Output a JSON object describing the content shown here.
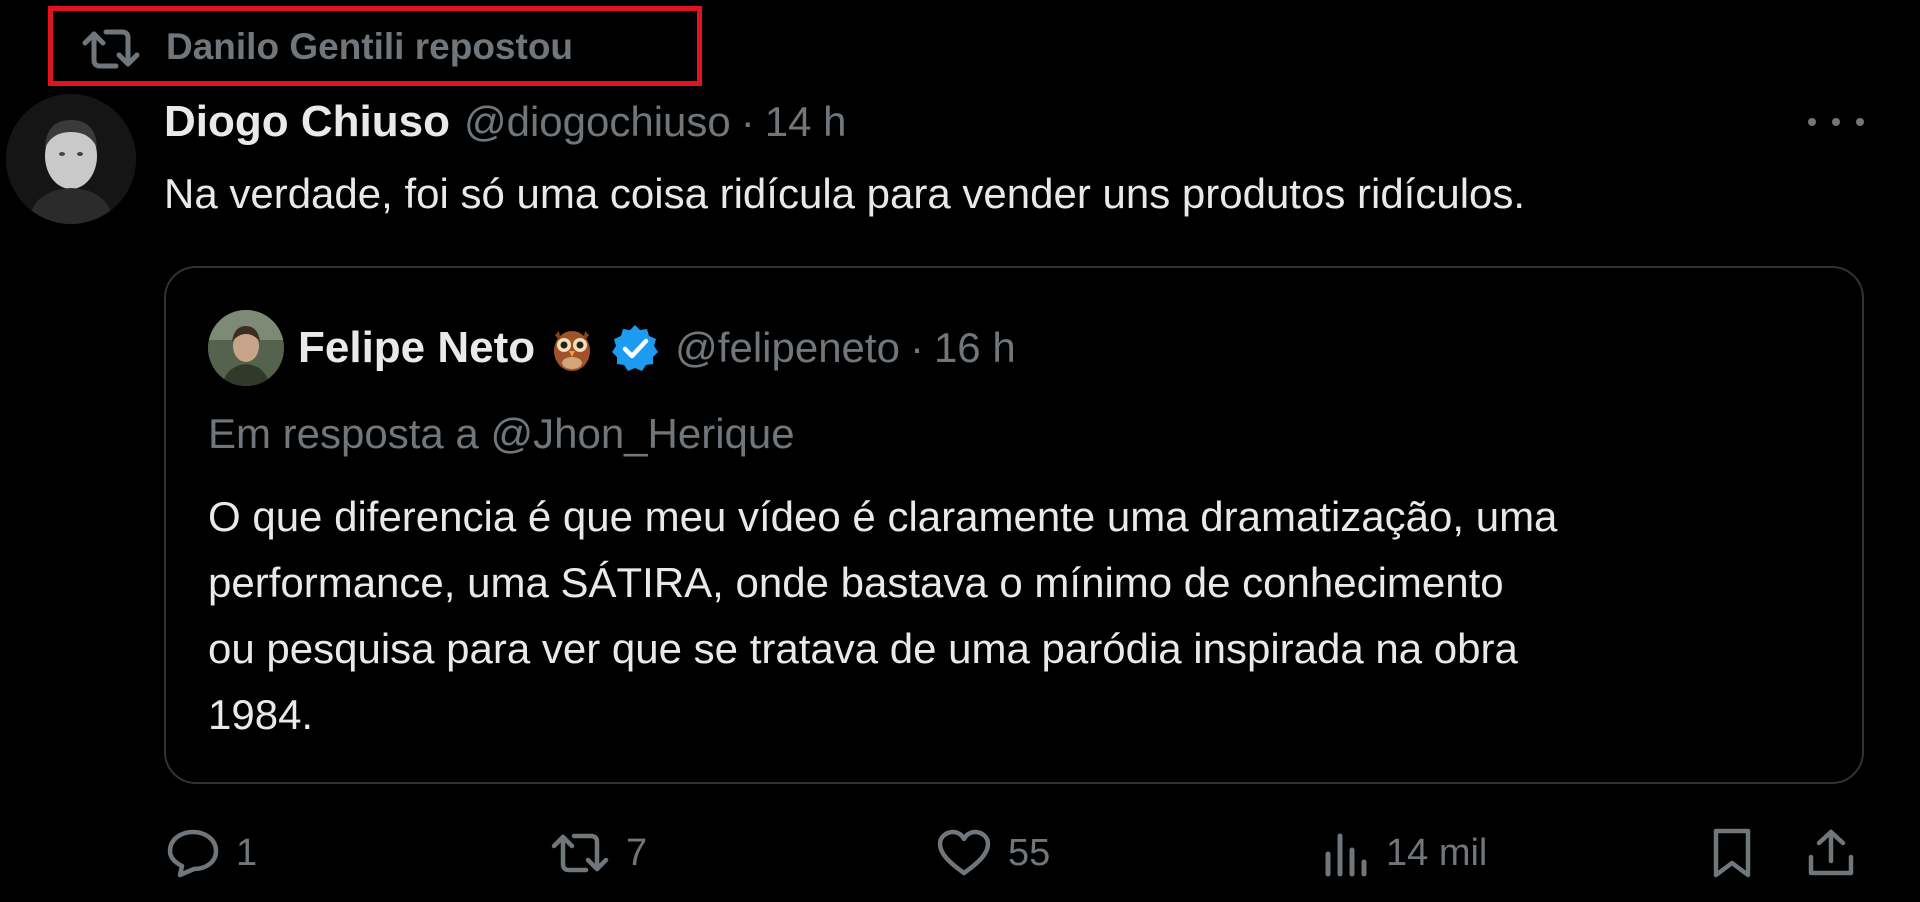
{
  "repost": {
    "text": "Danilo Gentili repostou",
    "icon": "repost-icon"
  },
  "tweet": {
    "author_name": "Diogo Chiuso",
    "author_handle": "@diogochiuso",
    "separator": "·",
    "time": "14 h",
    "text": "Na verdade, foi só uma coisa ridícula para vender uns produtos ridículos."
  },
  "quote": {
    "author_name": "Felipe Neto",
    "emoji": "owl-icon",
    "verified": "verified-badge-icon",
    "author_handle": "@felipeneto",
    "separator": "·",
    "time": "16 h",
    "reply_prefix": "Em resposta a",
    "reply_mention": "@Jhon_Herique",
    "lines": [
      "O que diferencia é que meu vídeo é claramente uma dramatização, uma",
      "performance, uma SÁTIRA, onde bastava o mínimo de conhecimento",
      "ou pesquisa para ver que se tratava de uma paródia inspirada na obra",
      "1984."
    ]
  },
  "actions": {
    "reply_count": "1",
    "repost_count": "7",
    "like_count": "55",
    "views_count": "14 mil"
  },
  "colors": {
    "background": "#000000",
    "text": "#e7e9ea",
    "muted": "#71767b",
    "border": "#2f3336",
    "verified": "#1d9bf0",
    "highlight": "#e0141e"
  }
}
